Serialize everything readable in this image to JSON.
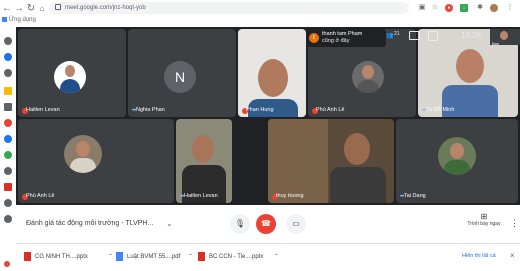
{
  "browser": {
    "url": "meet.google.com/jnz-hoqt-yob",
    "bookmark": "Ứng dụng"
  },
  "notification": {
    "initial": "t",
    "name": "thanh tam Pham",
    "message": "cũng ở đây",
    "time": "15:28",
    "participants_count": "21",
    "you_label": "Bạn"
  },
  "tiles": [
    {
      "name": "Haitlen Levan"
    },
    {
      "name": "Nghia Phan",
      "initial": "N"
    },
    {
      "name": "Phan Hung"
    },
    {
      "name": "Phú Anh Lê"
    },
    {
      "name": "Tú Đỗ Minh"
    },
    {
      "name": "Phú Anh Lê"
    },
    {
      "name": "Haitlen Levan"
    },
    {
      "name": "thuy truong"
    },
    {
      "name": "Tai Dang"
    }
  ],
  "meeting": {
    "title": "Đánh giá tác động môi trường - TLVPH...",
    "present_label": "Trình bày ngay"
  },
  "downloads": {
    "items": [
      "CG NINH TH....pptx",
      "Luật BVMT 55....pdf",
      "BC CCN - Tie....pptx"
    ],
    "show_all": "Hiển thị tất cả"
  },
  "colors": {
    "meet_bg": "#202124",
    "tile_bg": "#3c4043",
    "end_call": "#ea4335",
    "accent": "#1a73e8"
  }
}
